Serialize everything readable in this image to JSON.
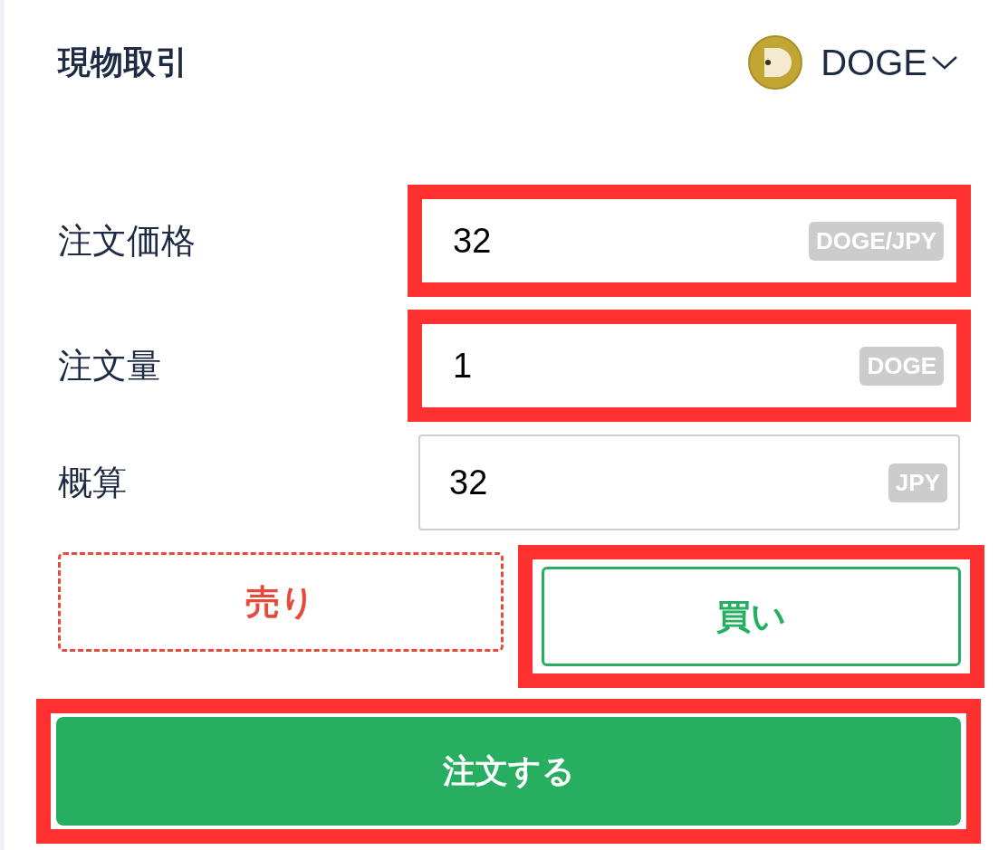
{
  "header": {
    "title": "現物取引",
    "coin": "DOGE"
  },
  "fields": [
    {
      "label": "注文価格",
      "value": "32",
      "unit": "DOGE/JPY",
      "highlighted": true
    },
    {
      "label": "注文量",
      "value": "1",
      "unit": "DOGE",
      "highlighted": true
    },
    {
      "label": "概算",
      "value": "32",
      "unit": "JPY",
      "highlighted": false
    }
  ],
  "sides": [
    {
      "kind": "sell",
      "label": "売り",
      "selected": false,
      "highlighted": false
    },
    {
      "kind": "buy",
      "label": "買い",
      "selected": true,
      "highlighted": true
    }
  ],
  "submit": {
    "label": "注文する",
    "highlighted": true
  }
}
